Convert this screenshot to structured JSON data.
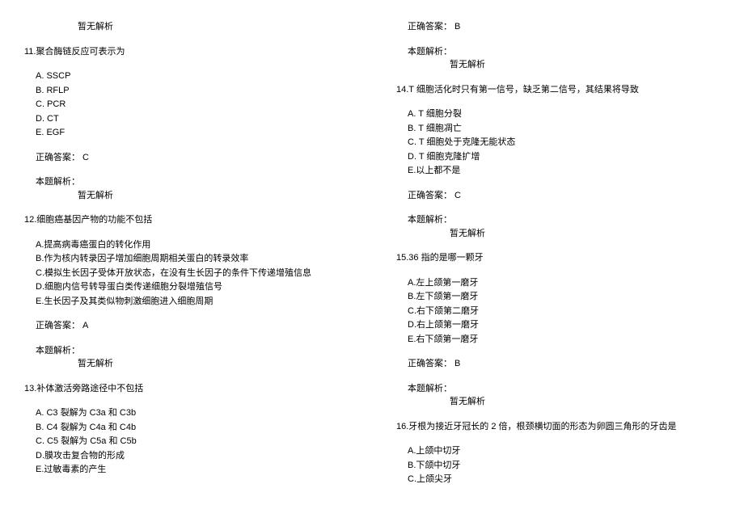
{
  "left": {
    "topAnalysis": "暂无解析",
    "q11": {
      "stem": "11.聚合酶链反应可表示为",
      "options": {
        "A": "A. SSCP",
        "B": "B. RFLP",
        "C": "C. PCR",
        "D": "D. CT",
        "E": "E. EGF"
      },
      "answer": "正确答案：  C",
      "analysisLabel": "本题解析：",
      "analysisBody": "暂无解析"
    },
    "q12": {
      "stem": "12.细胞癌基因产物的功能不包括",
      "options": {
        "A": "A.提高病毒癌蛋白的转化作用",
        "B": "B.作为核内转录因子增加细胞周期相关蛋白的转录效率",
        "C": "C.模拟生长因子受体开放状态，在没有生长因子的条件下传递增殖信息",
        "D": "D.细胞内信号转导蛋白类传递细胞分裂增殖信号",
        "E": "E.生长因子及其类似物刺激细胞进入细胞周期"
      },
      "answer": "正确答案：  A",
      "analysisLabel": "本题解析：",
      "analysisBody": "暂无解析"
    },
    "q13": {
      "stem": "13.补体激活旁路途径中不包括",
      "options": {
        "A": "A. C3 裂解为 C3a 和 C3b",
        "B": "B. C4 裂解为 C4a 和 C4b",
        "C": "C. C5 裂解为 C5a 和 C5b",
        "D": "D.膜攻击复合物的形成",
        "E": "E.过敏毒素的产生"
      }
    }
  },
  "right": {
    "topAnswer": "正确答案：  B",
    "topAnalysisLabel": "本题解析：",
    "topAnalysisBody": "暂无解析",
    "q14": {
      "stem": "14.T 细胞活化时只有第一信号，缺乏第二信号，其结果将导致",
      "options": {
        "A": "A. T 细胞分裂",
        "B": "B. T 细胞凋亡",
        "C": "C. T 细胞处于克隆无能状态",
        "D": "D. T 细胞克隆扩增",
        "E": "E.以上都不是"
      },
      "answer": "正确答案：  C",
      "analysisLabel": "本题解析：",
      "analysisBody": "暂无解析"
    },
    "q15": {
      "stem": "15.36 指的是哪一颗牙",
      "options": {
        "A": "A.左上颌第一磨牙",
        "B": "B.左下颌第一磨牙",
        "C": "C.右下颌第二磨牙",
        "D": "D.右上颌第一磨牙",
        "E": "E.右下颌第一磨牙"
      },
      "answer": "正确答案：  B",
      "analysisLabel": "本题解析：",
      "analysisBody": "暂无解析"
    },
    "q16": {
      "stem": "16.牙根为接近牙冠长的 2 倍，根颈横切面的形态为卵圆三角形的牙齿是",
      "options": {
        "A": "A.上颌中切牙",
        "B": "B.下颌中切牙",
        "C": "C.上颌尖牙"
      }
    }
  }
}
